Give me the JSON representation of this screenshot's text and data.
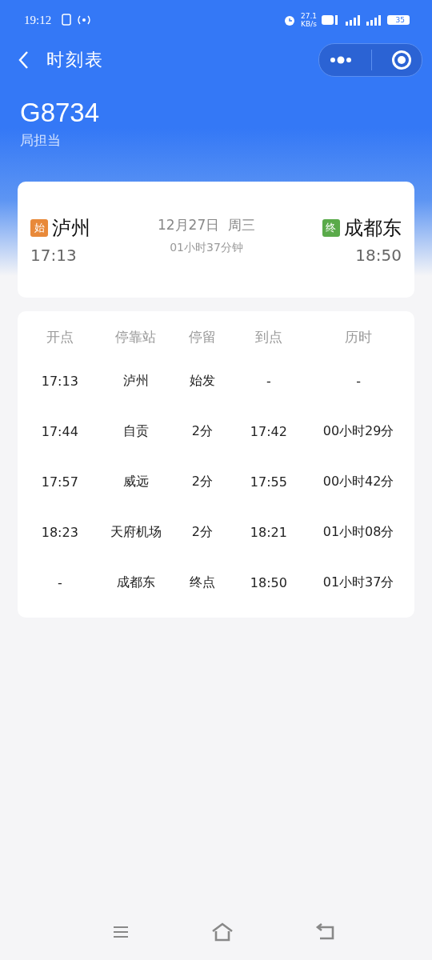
{
  "status_bar": {
    "time": "19:12",
    "net_speed": "27.1",
    "net_unit": "KB/s",
    "battery": "35"
  },
  "nav": {
    "title": "时刻表"
  },
  "train": {
    "number": "G8734",
    "subtitle": "局担当"
  },
  "journey": {
    "from": {
      "tag": "始",
      "color": "#e8893a",
      "station": "泸州",
      "time": "17:13"
    },
    "date": "12月27日",
    "weekday": "周三",
    "duration": "01小时37分钟",
    "to": {
      "tag": "终",
      "color": "#5aaa4a",
      "station": "成都东",
      "time": "18:50"
    }
  },
  "table": {
    "columns": [
      "开点",
      "停靠站",
      "停留",
      "到点",
      "历时"
    ],
    "rows": [
      [
        "17:13",
        "泸州",
        "始发",
        "-",
        "-"
      ],
      [
        "17:44",
        "自贡",
        "2分",
        "17:42",
        "00小时29分"
      ],
      [
        "17:57",
        "威远",
        "2分",
        "17:55",
        "00小时42分"
      ],
      [
        "18:23",
        "天府机场",
        "2分",
        "18:21",
        "01小时08分"
      ],
      [
        "-",
        "成都东",
        "终点",
        "18:50",
        "01小时37分"
      ]
    ]
  }
}
